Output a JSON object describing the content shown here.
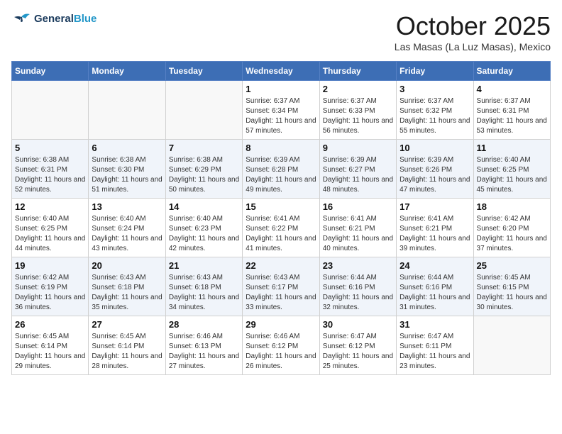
{
  "header": {
    "logo_line1": "General",
    "logo_line2": "Blue",
    "month": "October 2025",
    "location": "Las Masas (La Luz Masas), Mexico"
  },
  "days_of_week": [
    "Sunday",
    "Monday",
    "Tuesday",
    "Wednesday",
    "Thursday",
    "Friday",
    "Saturday"
  ],
  "weeks": [
    [
      {
        "day": "",
        "info": ""
      },
      {
        "day": "",
        "info": ""
      },
      {
        "day": "",
        "info": ""
      },
      {
        "day": "1",
        "info": "Sunrise: 6:37 AM\nSunset: 6:34 PM\nDaylight: 11 hours and 57 minutes."
      },
      {
        "day": "2",
        "info": "Sunrise: 6:37 AM\nSunset: 6:33 PM\nDaylight: 11 hours and 56 minutes."
      },
      {
        "day": "3",
        "info": "Sunrise: 6:37 AM\nSunset: 6:32 PM\nDaylight: 11 hours and 55 minutes."
      },
      {
        "day": "4",
        "info": "Sunrise: 6:37 AM\nSunset: 6:31 PM\nDaylight: 11 hours and 53 minutes."
      }
    ],
    [
      {
        "day": "5",
        "info": "Sunrise: 6:38 AM\nSunset: 6:31 PM\nDaylight: 11 hours and 52 minutes."
      },
      {
        "day": "6",
        "info": "Sunrise: 6:38 AM\nSunset: 6:30 PM\nDaylight: 11 hours and 51 minutes."
      },
      {
        "day": "7",
        "info": "Sunrise: 6:38 AM\nSunset: 6:29 PM\nDaylight: 11 hours and 50 minutes."
      },
      {
        "day": "8",
        "info": "Sunrise: 6:39 AM\nSunset: 6:28 PM\nDaylight: 11 hours and 49 minutes."
      },
      {
        "day": "9",
        "info": "Sunrise: 6:39 AM\nSunset: 6:27 PM\nDaylight: 11 hours and 48 minutes."
      },
      {
        "day": "10",
        "info": "Sunrise: 6:39 AM\nSunset: 6:26 PM\nDaylight: 11 hours and 47 minutes."
      },
      {
        "day": "11",
        "info": "Sunrise: 6:40 AM\nSunset: 6:25 PM\nDaylight: 11 hours and 45 minutes."
      }
    ],
    [
      {
        "day": "12",
        "info": "Sunrise: 6:40 AM\nSunset: 6:25 PM\nDaylight: 11 hours and 44 minutes."
      },
      {
        "day": "13",
        "info": "Sunrise: 6:40 AM\nSunset: 6:24 PM\nDaylight: 11 hours and 43 minutes."
      },
      {
        "day": "14",
        "info": "Sunrise: 6:40 AM\nSunset: 6:23 PM\nDaylight: 11 hours and 42 minutes."
      },
      {
        "day": "15",
        "info": "Sunrise: 6:41 AM\nSunset: 6:22 PM\nDaylight: 11 hours and 41 minutes."
      },
      {
        "day": "16",
        "info": "Sunrise: 6:41 AM\nSunset: 6:21 PM\nDaylight: 11 hours and 40 minutes."
      },
      {
        "day": "17",
        "info": "Sunrise: 6:41 AM\nSunset: 6:21 PM\nDaylight: 11 hours and 39 minutes."
      },
      {
        "day": "18",
        "info": "Sunrise: 6:42 AM\nSunset: 6:20 PM\nDaylight: 11 hours and 37 minutes."
      }
    ],
    [
      {
        "day": "19",
        "info": "Sunrise: 6:42 AM\nSunset: 6:19 PM\nDaylight: 11 hours and 36 minutes."
      },
      {
        "day": "20",
        "info": "Sunrise: 6:43 AM\nSunset: 6:18 PM\nDaylight: 11 hours and 35 minutes."
      },
      {
        "day": "21",
        "info": "Sunrise: 6:43 AM\nSunset: 6:18 PM\nDaylight: 11 hours and 34 minutes."
      },
      {
        "day": "22",
        "info": "Sunrise: 6:43 AM\nSunset: 6:17 PM\nDaylight: 11 hours and 33 minutes."
      },
      {
        "day": "23",
        "info": "Sunrise: 6:44 AM\nSunset: 6:16 PM\nDaylight: 11 hours and 32 minutes."
      },
      {
        "day": "24",
        "info": "Sunrise: 6:44 AM\nSunset: 6:16 PM\nDaylight: 11 hours and 31 minutes."
      },
      {
        "day": "25",
        "info": "Sunrise: 6:45 AM\nSunset: 6:15 PM\nDaylight: 11 hours and 30 minutes."
      }
    ],
    [
      {
        "day": "26",
        "info": "Sunrise: 6:45 AM\nSunset: 6:14 PM\nDaylight: 11 hours and 29 minutes."
      },
      {
        "day": "27",
        "info": "Sunrise: 6:45 AM\nSunset: 6:14 PM\nDaylight: 11 hours and 28 minutes."
      },
      {
        "day": "28",
        "info": "Sunrise: 6:46 AM\nSunset: 6:13 PM\nDaylight: 11 hours and 27 minutes."
      },
      {
        "day": "29",
        "info": "Sunrise: 6:46 AM\nSunset: 6:12 PM\nDaylight: 11 hours and 26 minutes."
      },
      {
        "day": "30",
        "info": "Sunrise: 6:47 AM\nSunset: 6:12 PM\nDaylight: 11 hours and 25 minutes."
      },
      {
        "day": "31",
        "info": "Sunrise: 6:47 AM\nSunset: 6:11 PM\nDaylight: 11 hours and 23 minutes."
      },
      {
        "day": "",
        "info": ""
      }
    ]
  ]
}
